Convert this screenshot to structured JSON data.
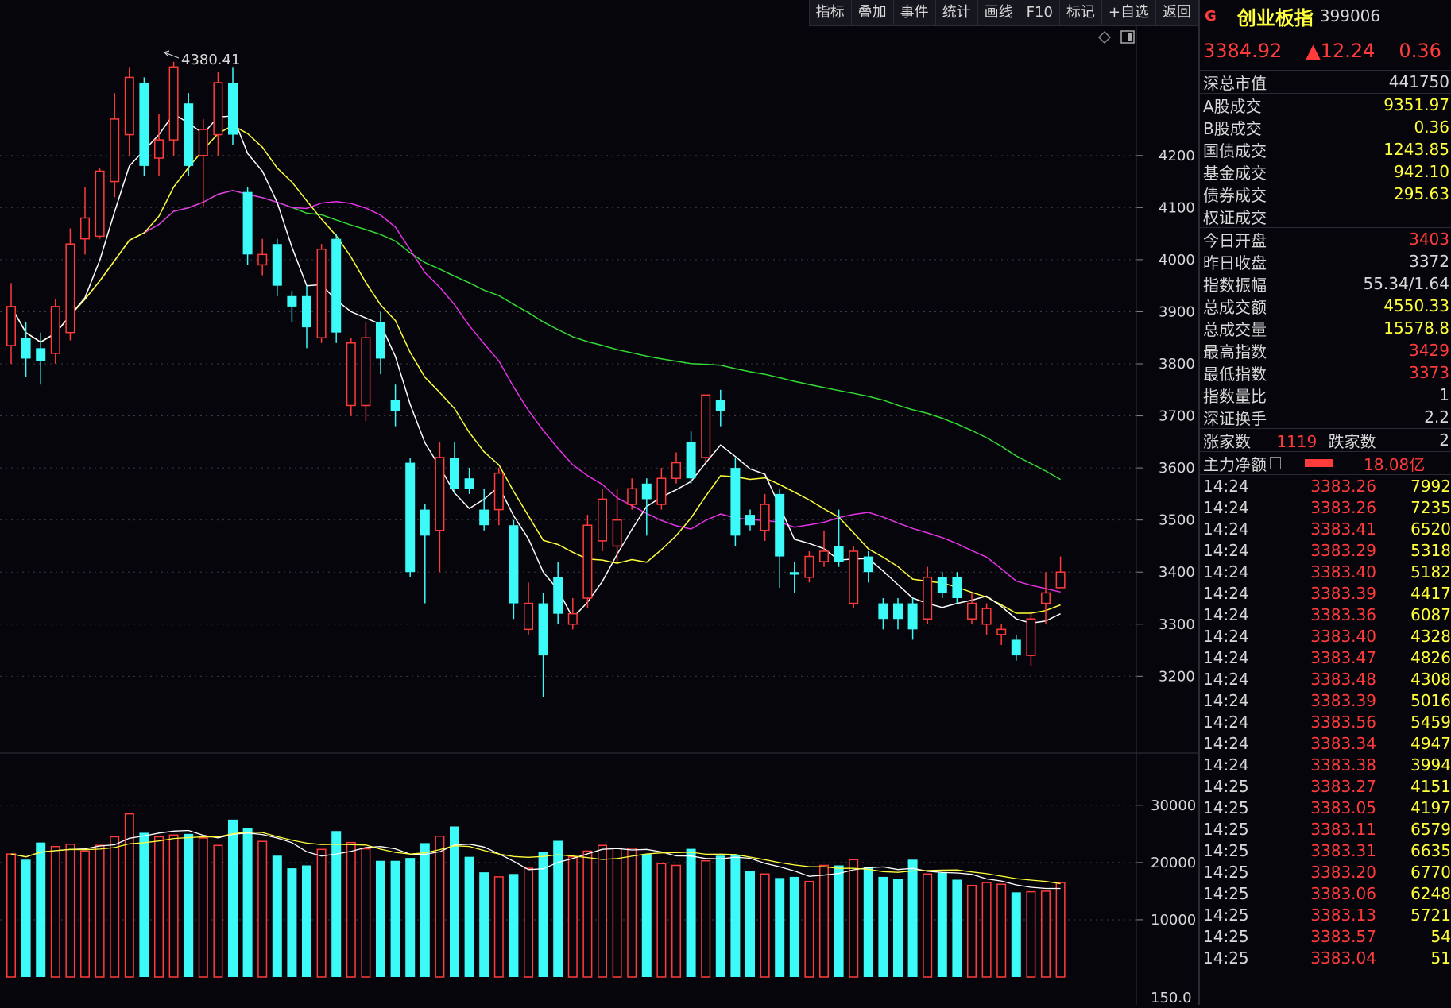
{
  "toolbar": {
    "items": [
      "指标",
      "叠加",
      "事件",
      "统计",
      "画线",
      "F10",
      "标记",
      "+自选",
      "返回"
    ]
  },
  "panel": {
    "badge": "G",
    "name": "创业板指",
    "code": "399006",
    "price": "3384.92",
    "change": "▲12.24",
    "pct": "0.36",
    "market_cap": {
      "label": "深总市值",
      "value": "441750"
    },
    "turnover": [
      {
        "label": "A股成交",
        "value": "9351.97"
      },
      {
        "label": "B股成交",
        "value": "0.36"
      },
      {
        "label": "国债成交",
        "value": "1243.85"
      },
      {
        "label": "基金成交",
        "value": "942.10"
      },
      {
        "label": "债券成交",
        "value": "295.63"
      },
      {
        "label": "权证成交",
        "value": ""
      }
    ],
    "stats": [
      {
        "label": "今日开盘",
        "value": "3403",
        "color": "red"
      },
      {
        "label": "昨日收盘",
        "value": "3372",
        "color": "wht"
      },
      {
        "label": "指数振幅",
        "value": "55.34/1.64",
        "color": "wht"
      },
      {
        "label": "总成交额",
        "value": "4550.33",
        "color": "yel"
      },
      {
        "label": "总成交量",
        "value": "15578.8",
        "color": "yel"
      },
      {
        "label": "最高指数",
        "value": "3429",
        "color": "red"
      },
      {
        "label": "最低指数",
        "value": "3373",
        "color": "red"
      },
      {
        "label": "指数量比",
        "value": "1",
        "color": "wht"
      },
      {
        "label": "深证换手",
        "value": "2.2",
        "color": "wht"
      }
    ],
    "breadth": {
      "up_label": "涨家数",
      "up_value": "1119",
      "down_label": "跌家数",
      "down_value": "2"
    },
    "main_flow": {
      "label": "主力净额",
      "value": "18.08亿"
    },
    "ticks": [
      {
        "time": "14:24",
        "price": "3383.26",
        "vol": "7992"
      },
      {
        "time": "14:24",
        "price": "3383.26",
        "vol": "7235"
      },
      {
        "time": "14:24",
        "price": "3383.41",
        "vol": "6520"
      },
      {
        "time": "14:24",
        "price": "3383.29",
        "vol": "5318"
      },
      {
        "time": "14:24",
        "price": "3383.40",
        "vol": "5182"
      },
      {
        "time": "14:24",
        "price": "3383.39",
        "vol": "4417"
      },
      {
        "time": "14:24",
        "price": "3383.36",
        "vol": "6087"
      },
      {
        "time": "14:24",
        "price": "3383.40",
        "vol": "4328"
      },
      {
        "time": "14:24",
        "price": "3383.47",
        "vol": "4826"
      },
      {
        "time": "14:24",
        "price": "3383.48",
        "vol": "4308"
      },
      {
        "time": "14:24",
        "price": "3383.39",
        "vol": "5016"
      },
      {
        "time": "14:24",
        "price": "3383.56",
        "vol": "5459"
      },
      {
        "time": "14:24",
        "price": "3383.34",
        "vol": "4947"
      },
      {
        "time": "14:24",
        "price": "3383.38",
        "vol": "3994"
      },
      {
        "time": "14:25",
        "price": "3383.27",
        "vol": "4151"
      },
      {
        "time": "14:25",
        "price": "3383.05",
        "vol": "4197"
      },
      {
        "time": "14:25",
        "price": "3383.11",
        "vol": "6579"
      },
      {
        "time": "14:25",
        "price": "3383.31",
        "vol": "6635"
      },
      {
        "time": "14:25",
        "price": "3383.20",
        "vol": "6770"
      },
      {
        "time": "14:25",
        "price": "3383.06",
        "vol": "6248"
      },
      {
        "time": "14:25",
        "price": "3383.13",
        "vol": "5721"
      },
      {
        "time": "14:25",
        "price": "3383.57",
        "vol": "54"
      },
      {
        "time": "14:25",
        "price": "3383.04",
        "vol": "51"
      }
    ]
  },
  "chart_data": {
    "type": "candlestick",
    "price_axis": {
      "ticks": [
        4200,
        4100,
        4000,
        3900,
        3800,
        3700,
        3600,
        3500,
        3400,
        3300,
        3200
      ],
      "range": [
        3080,
        4430
      ]
    },
    "volume_axis": {
      "ticks": [
        30000,
        20000,
        10000
      ],
      "range": [
        0,
        34000
      ]
    },
    "high_annotation": "4380.41",
    "extra_label": "150.0",
    "colors": {
      "up": "#ff3b3b",
      "down": "#3cfaf8",
      "ma5": "#ffffff",
      "ma10": "#ffff3b",
      "ma20": "#e632e6",
      "ma60": "#32dc32"
    },
    "candles": [
      {
        "o": 3835,
        "c": 3910,
        "h": 3955,
        "l": 3800,
        "v": 21500
      },
      {
        "o": 3850,
        "c": 3810,
        "h": 3880,
        "l": 3775,
        "v": 20500
      },
      {
        "o": 3830,
        "c": 3805,
        "h": 3860,
        "l": 3760,
        "v": 23500
      },
      {
        "o": 3820,
        "c": 3910,
        "h": 3925,
        "l": 3800,
        "v": 22800
      },
      {
        "o": 3860,
        "c": 4030,
        "h": 4060,
        "l": 3845,
        "v": 23200
      },
      {
        "o": 4040,
        "c": 4080,
        "h": 4140,
        "l": 4010,
        "v": 22000
      },
      {
        "o": 4045,
        "c": 4170,
        "h": 4175,
        "l": 4040,
        "v": 23000
      },
      {
        "o": 4150,
        "c": 4270,
        "h": 4320,
        "l": 4120,
        "v": 24500
      },
      {
        "o": 4240,
        "c": 4350,
        "h": 4370,
        "l": 4200,
        "v": 28500
      },
      {
        "o": 4340,
        "c": 4180,
        "h": 4350,
        "l": 4160,
        "v": 25200
      },
      {
        "o": 4195,
        "c": 4230,
        "h": 4280,
        "l": 4160,
        "v": 24500
      },
      {
        "o": 4230,
        "c": 4370,
        "h": 4380,
        "l": 4200,
        "v": 24800
      },
      {
        "o": 4300,
        "c": 4180,
        "h": 4320,
        "l": 4160,
        "v": 25000
      },
      {
        "o": 4200,
        "c": 4250,
        "h": 4270,
        "l": 4100,
        "v": 24300
      },
      {
        "o": 4240,
        "c": 4340,
        "h": 4360,
        "l": 4200,
        "v": 23000
      },
      {
        "o": 4340,
        "c": 4240,
        "h": 4370,
        "l": 4220,
        "v": 27500
      },
      {
        "o": 4130,
        "c": 4010,
        "h": 4140,
        "l": 3990,
        "v": 26000
      },
      {
        "o": 3990,
        "c": 4010,
        "h": 4040,
        "l": 3970,
        "v": 23700
      },
      {
        "o": 4030,
        "c": 3950,
        "h": 4040,
        "l": 3930,
        "v": 21200
      },
      {
        "o": 3930,
        "c": 3910,
        "h": 3940,
        "l": 3880,
        "v": 19000
      },
      {
        "o": 3930,
        "c": 3870,
        "h": 3950,
        "l": 3830,
        "v": 19500
      },
      {
        "o": 3850,
        "c": 4020,
        "h": 4030,
        "l": 3840,
        "v": 22300
      },
      {
        "o": 4040,
        "c": 3860,
        "h": 4050,
        "l": 3840,
        "v": 25500
      },
      {
        "o": 3720,
        "c": 3840,
        "h": 3850,
        "l": 3700,
        "v": 23500
      },
      {
        "o": 3720,
        "c": 3850,
        "h": 3880,
        "l": 3690,
        "v": 22400
      },
      {
        "o": 3880,
        "c": 3810,
        "h": 3900,
        "l": 3780,
        "v": 20300
      },
      {
        "o": 3730,
        "c": 3710,
        "h": 3760,
        "l": 3680,
        "v": 20300
      },
      {
        "o": 3610,
        "c": 3400,
        "h": 3620,
        "l": 3390,
        "v": 20800
      },
      {
        "o": 3520,
        "c": 3470,
        "h": 3530,
        "l": 3340,
        "v": 23400
      },
      {
        "o": 3480,
        "c": 3620,
        "h": 3650,
        "l": 3400,
        "v": 24600
      },
      {
        "o": 3620,
        "c": 3560,
        "h": 3650,
        "l": 3550,
        "v": 26300
      },
      {
        "o": 3580,
        "c": 3560,
        "h": 3600,
        "l": 3550,
        "v": 21000
      },
      {
        "o": 3520,
        "c": 3490,
        "h": 3560,
        "l": 3480,
        "v": 18300
      },
      {
        "o": 3520,
        "c": 3590,
        "h": 3600,
        "l": 3490,
        "v": 17500
      },
      {
        "o": 3490,
        "c": 3340,
        "h": 3500,
        "l": 3310,
        "v": 18000
      },
      {
        "o": 3290,
        "c": 3340,
        "h": 3380,
        "l": 3280,
        "v": 19000
      },
      {
        "o": 3340,
        "c": 3240,
        "h": 3360,
        "l": 3160,
        "v": 21800
      },
      {
        "o": 3390,
        "c": 3320,
        "h": 3420,
        "l": 3300,
        "v": 23800
      },
      {
        "o": 3300,
        "c": 3320,
        "h": 3350,
        "l": 3290,
        "v": 21000
      },
      {
        "o": 3350,
        "c": 3490,
        "h": 3510,
        "l": 3330,
        "v": 22000
      },
      {
        "o": 3460,
        "c": 3540,
        "h": 3560,
        "l": 3440,
        "v": 23000
      },
      {
        "o": 3450,
        "c": 3500,
        "h": 3560,
        "l": 3420,
        "v": 22500
      },
      {
        "o": 3530,
        "c": 3560,
        "h": 3580,
        "l": 3520,
        "v": 22500
      },
      {
        "o": 3570,
        "c": 3540,
        "h": 3580,
        "l": 3470,
        "v": 21500
      },
      {
        "o": 3530,
        "c": 3580,
        "h": 3600,
        "l": 3520,
        "v": 19800
      },
      {
        "o": 3580,
        "c": 3610,
        "h": 3630,
        "l": 3570,
        "v": 19500
      },
      {
        "o": 3650,
        "c": 3580,
        "h": 3670,
        "l": 3570,
        "v": 22400
      },
      {
        "o": 3620,
        "c": 3740,
        "h": 3740,
        "l": 3610,
        "v": 20300
      },
      {
        "o": 3730,
        "c": 3710,
        "h": 3750,
        "l": 3680,
        "v": 21200
      },
      {
        "o": 3600,
        "c": 3470,
        "h": 3620,
        "l": 3450,
        "v": 21300
      },
      {
        "o": 3510,
        "c": 3490,
        "h": 3520,
        "l": 3480,
        "v": 18500
      },
      {
        "o": 3480,
        "c": 3530,
        "h": 3550,
        "l": 3460,
        "v": 18000
      },
      {
        "o": 3550,
        "c": 3430,
        "h": 3560,
        "l": 3370,
        "v": 17300
      },
      {
        "o": 3400,
        "c": 3395,
        "h": 3420,
        "l": 3360,
        "v": 17500
      },
      {
        "o": 3390,
        "c": 3430,
        "h": 3440,
        "l": 3380,
        "v": 16700
      },
      {
        "o": 3420,
        "c": 3440,
        "h": 3480,
        "l": 3410,
        "v": 19500
      },
      {
        "o": 3450,
        "c": 3420,
        "h": 3520,
        "l": 3410,
        "v": 19500
      },
      {
        "o": 3340,
        "c": 3440,
        "h": 3450,
        "l": 3330,
        "v": 20500
      },
      {
        "o": 3430,
        "c": 3400,
        "h": 3440,
        "l": 3380,
        "v": 19200
      },
      {
        "o": 3340,
        "c": 3310,
        "h": 3350,
        "l": 3290,
        "v": 17500
      },
      {
        "o": 3340,
        "c": 3310,
        "h": 3350,
        "l": 3290,
        "v": 17200
      },
      {
        "o": 3340,
        "c": 3290,
        "h": 3350,
        "l": 3270,
        "v": 20500
      },
      {
        "o": 3310,
        "c": 3390,
        "h": 3410,
        "l": 3300,
        "v": 18000
      },
      {
        "o": 3390,
        "c": 3360,
        "h": 3400,
        "l": 3350,
        "v": 18200
      },
      {
        "o": 3390,
        "c": 3350,
        "h": 3400,
        "l": 3340,
        "v": 17000
      },
      {
        "o": 3310,
        "c": 3340,
        "h": 3360,
        "l": 3300,
        "v": 16000
      },
      {
        "o": 3300,
        "c": 3330,
        "h": 3340,
        "l": 3280,
        "v": 16500
      },
      {
        "o": 3280,
        "c": 3290,
        "h": 3300,
        "l": 3260,
        "v": 16200
      },
      {
        "o": 3270,
        "c": 3240,
        "h": 3280,
        "l": 3230,
        "v": 14800
      },
      {
        "o": 3240,
        "c": 3310,
        "h": 3320,
        "l": 3220,
        "v": 14900
      },
      {
        "o": 3340,
        "c": 3360,
        "h": 3400,
        "l": 3300,
        "v": 15000
      },
      {
        "o": 3370,
        "c": 3400,
        "h": 3430,
        "l": 3370,
        "v": 16500
      }
    ]
  }
}
